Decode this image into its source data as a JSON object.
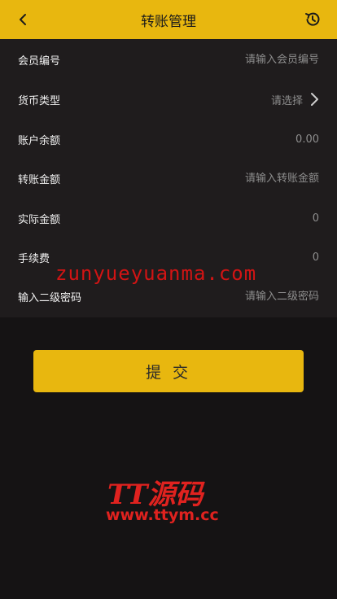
{
  "header": {
    "title": "转账管理",
    "back_icon": "chevron-left-icon",
    "history_icon": "history-clock-icon",
    "accent_color": "#e8b70f"
  },
  "form": {
    "member_id": {
      "label": "会员编号",
      "placeholder": "请输入会员编号"
    },
    "currency": {
      "label": "货币类型",
      "value": "请选择"
    },
    "balance": {
      "label": "账户余额",
      "value": "0.00"
    },
    "transfer_amount": {
      "label": "转账金额",
      "placeholder": "请输入转账金额"
    },
    "actual_amount": {
      "label": "实际金额",
      "value": "0"
    },
    "fee": {
      "label": "手续费",
      "value": "0"
    },
    "password": {
      "label": "输入二级密码",
      "placeholder": "请输入二级密码"
    }
  },
  "submit_label": "提 交",
  "watermarks": {
    "top": "zunyueyuanma.com",
    "logo": "TT源码",
    "url": "www.ttym.cc"
  }
}
